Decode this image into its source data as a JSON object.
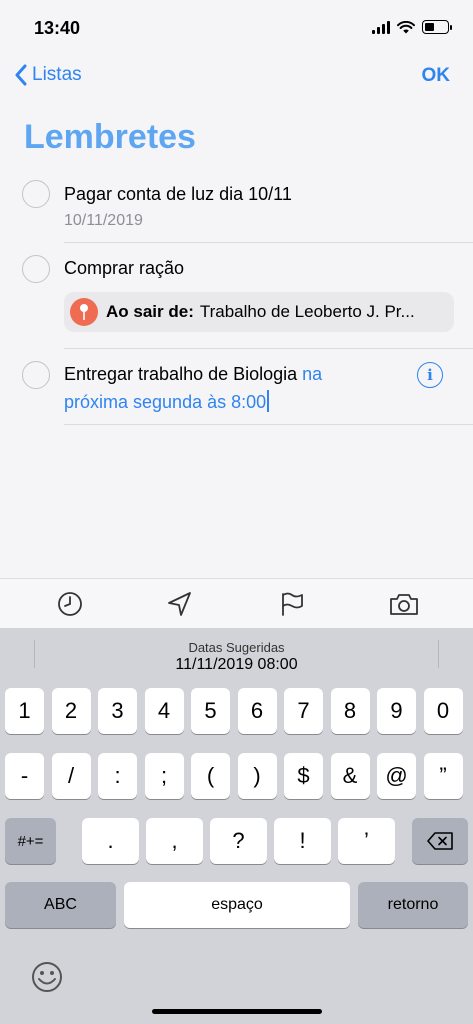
{
  "status": {
    "time": "13:40"
  },
  "nav": {
    "back_label": "Listas",
    "ok_label": "OK"
  },
  "title": "Lembretes",
  "reminders": [
    {
      "text": "Pagar conta de luz dia 10/11",
      "sub": "10/11/2019"
    },
    {
      "text": "Comprar ração",
      "location_label": "Ao sair de:",
      "location_value": "Trabalho de Leoberto J. Pr..."
    },
    {
      "text_plain": "Entregar trabalho de Biologia ",
      "text_highlight_1": "na",
      "text_highlight_2": "próxima segunda às 8:00"
    }
  ],
  "toolbar": {
    "icons": [
      "clock-icon",
      "location-arrow-icon",
      "flag-icon",
      "camera-icon"
    ]
  },
  "keyboard": {
    "suggestion_title": "Datas Sugeridas",
    "suggestion_value": "11/11/2019 08:00",
    "row1": [
      "1",
      "2",
      "3",
      "4",
      "5",
      "6",
      "7",
      "8",
      "9",
      "0"
    ],
    "row2": [
      "-",
      "/",
      ":",
      ";",
      "(",
      ")",
      "$",
      "&",
      "@",
      "”"
    ],
    "row3_left": "#+=",
    "row3": [
      ".",
      ",",
      "?",
      "!",
      "’"
    ],
    "abc": "ABC",
    "space": "espaço",
    "return": "retorno"
  },
  "colors": {
    "accent": "#2f84f0",
    "title": "#5ea6f2",
    "pin": "#ef6b52"
  }
}
